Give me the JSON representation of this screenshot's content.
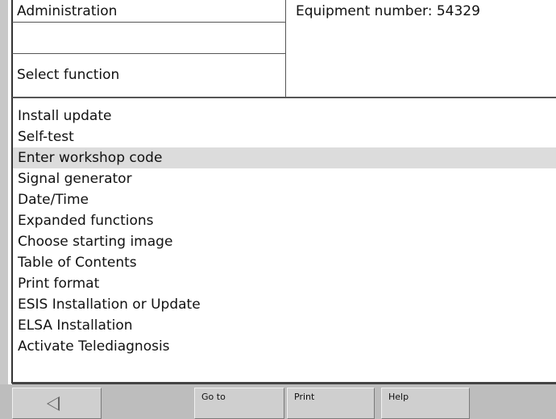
{
  "header": {
    "title": "Administration",
    "equipment_number": "Equipment number: 54329",
    "subtitle": "Select function"
  },
  "menu": {
    "selected_index": 2,
    "items": [
      {
        "label": "Install update"
      },
      {
        "label": "Self-test"
      },
      {
        "label": "Enter workshop code"
      },
      {
        "label": "Signal generator"
      },
      {
        "label": "Date/Time"
      },
      {
        "label": "Expanded functions"
      },
      {
        "label": "Choose starting image"
      },
      {
        "label": "Table of Contents"
      },
      {
        "label": "Print format"
      },
      {
        "label": "ESIS Installation or Update"
      },
      {
        "label": "ELSA Installation"
      },
      {
        "label": "Activate Telediagnosis"
      }
    ]
  },
  "toolbar": {
    "back_icon": "left-triangle-icon",
    "goto_label": "Go to",
    "print_label": "Print",
    "help_label": "Help"
  },
  "colors": {
    "selected_row": "#dcdcdc",
    "toolbar_bg": "#bdbdbd",
    "button_bg": "#cfcfcf"
  }
}
